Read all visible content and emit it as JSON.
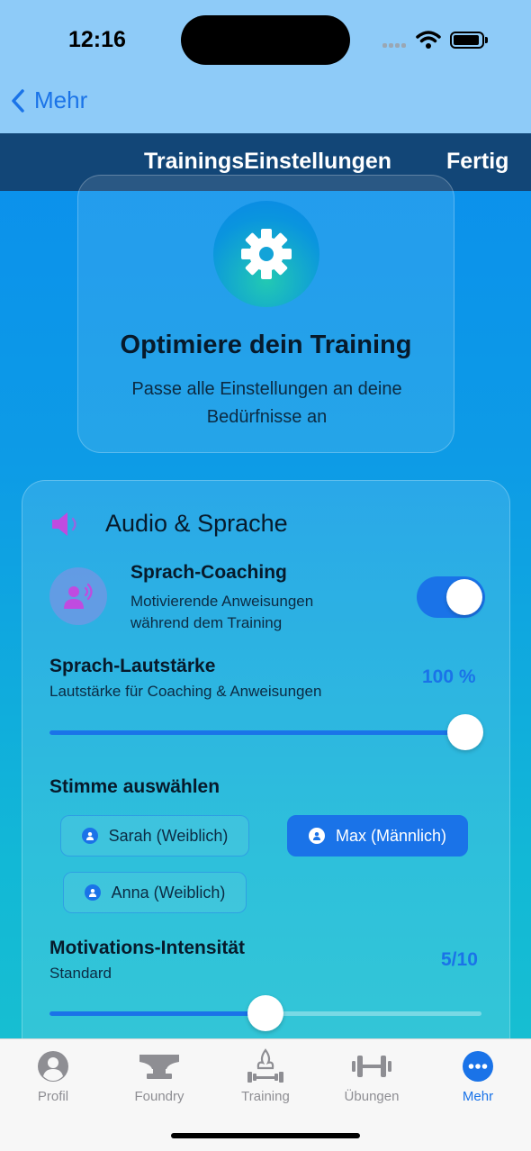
{
  "status": {
    "time": "12:16"
  },
  "nav": {
    "back_label": "Mehr",
    "title": "TrainingsEinstellungen",
    "done_label": "Fertig"
  },
  "hero": {
    "icon": "gear-icon",
    "headline": "Optimiere dein Training",
    "subtitle": "Passe alle Einstellungen an deine Bedürfnisse an"
  },
  "audio": {
    "section_icon": "speaker-icon",
    "section_title": "Audio & Sprache",
    "coaching": {
      "title": "Sprach-Coaching",
      "description": "Motivierende Anweisungen während dem Training",
      "enabled": true
    },
    "volume": {
      "label": "Sprach-Lautstärke",
      "description": "Lautstärke für Coaching & Anweisungen",
      "value_text": "100 %",
      "value": 1.0
    },
    "voice": {
      "label": "Stimme auswählen",
      "options": [
        "Sarah (Weiblich)",
        "Max (Männlich)",
        "Anna (Weiblich)"
      ],
      "selected": "Max (Männlich)"
    },
    "motivation": {
      "label": "Motivations-Intensität",
      "description": "Standard",
      "value_text": "5/10",
      "value": 0.5
    }
  },
  "tabs": [
    {
      "label": "Profil",
      "icon": "profile-icon"
    },
    {
      "label": "Foundry",
      "icon": "anvil-icon"
    },
    {
      "label": "Training",
      "icon": "training-icon"
    },
    {
      "label": "Übungen",
      "icon": "dumbbell-icon"
    },
    {
      "label": "Mehr",
      "icon": "more-icon",
      "active": true
    }
  ],
  "colors": {
    "accent": "#1a73e8",
    "header": "#124677",
    "status_bg": "#8ecbf8"
  }
}
